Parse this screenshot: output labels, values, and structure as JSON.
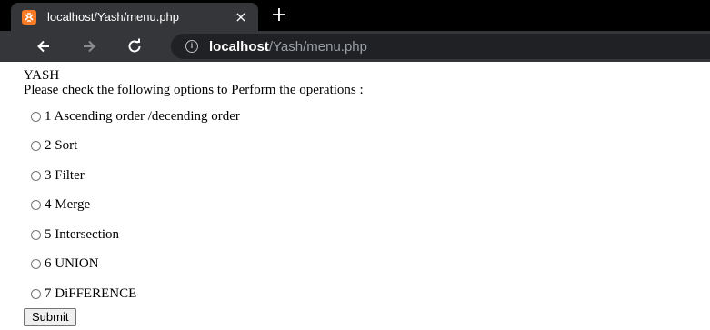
{
  "browser": {
    "tab_title": "localhost/Yash/menu.php",
    "tab_close": "×",
    "new_tab": "+",
    "url_host": "localhost",
    "url_path": "/Yash/menu.php",
    "tab_color": "#35363a",
    "favicon_color": "#fb7a24"
  },
  "page": {
    "title": "YASH",
    "instruction": "Please check the following options to Perform the operations :",
    "options": [
      "1 Ascending order /decending order",
      "2 Sort",
      "3 Filter",
      "4 Merge",
      "5 Intersection",
      "6 UNION",
      "7 DiFFERENCE"
    ],
    "submit_label": "Submit"
  }
}
